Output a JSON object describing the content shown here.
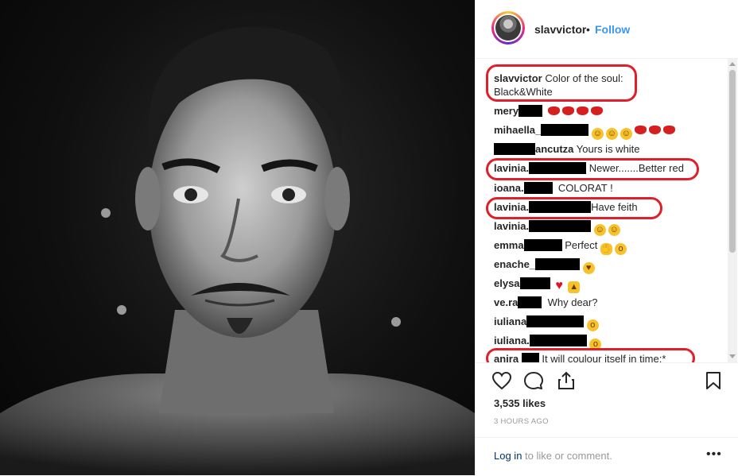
{
  "post": {
    "username": "slavvictor",
    "separator": "•",
    "follow_label": "Follow",
    "caption_user": "slavvictor",
    "caption_text": "Color of the soul:",
    "caption_text2": "Black&White"
  },
  "comments": [
    {
      "user": "mery",
      "text": ""
    },
    {
      "user": "mihaella_",
      "text": ""
    },
    {
      "user": "ancutza",
      "text": "Yours is white"
    },
    {
      "user": "lavinia.",
      "text": "Newer.......Better red"
    },
    {
      "user": "ioana.",
      "text": "COLORAT !"
    },
    {
      "user": "lavinia.",
      "text": "Have feith"
    },
    {
      "user": "lavinia.",
      "text": ""
    },
    {
      "user": "emma",
      "text": "Perfect"
    },
    {
      "user": "enache_",
      "text": ""
    },
    {
      "user": "elysa",
      "text": ""
    },
    {
      "user": "ve.ra",
      "text": "Why dear?"
    },
    {
      "user": "iuliana",
      "text": ""
    },
    {
      "user": "iuliana.",
      "text": ""
    },
    {
      "user": "anira",
      "text": "It will coulour itself in time:*"
    }
  ],
  "stats": {
    "likes": "3,535 likes",
    "time": "3 HOURS AGO"
  },
  "footer": {
    "login_link": "Log in",
    "login_rest": " to like or comment.",
    "more": "•••"
  },
  "icons": {
    "like": "heart-icon",
    "comment": "comment-icon",
    "share": "share-icon",
    "save": "bookmark-icon",
    "more": "more-options-icon"
  },
  "colors": {
    "accent": "#3897f0",
    "annotation": "#e01f2a"
  }
}
